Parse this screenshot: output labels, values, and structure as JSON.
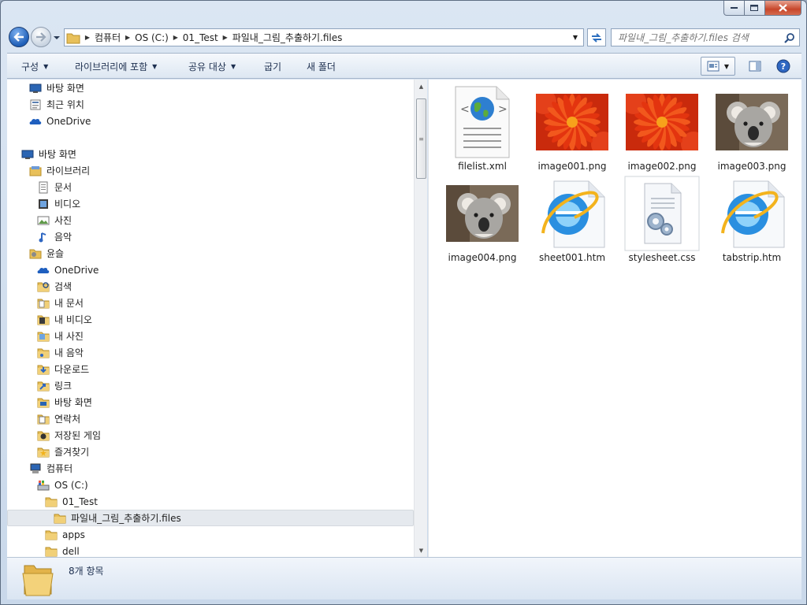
{
  "window": {
    "caption_buttons": [
      "minimize",
      "maximize",
      "close"
    ]
  },
  "address": {
    "segments": [
      "컴퓨터",
      "OS (C:)",
      "01_Test",
      "파일내_그림_추출하기.files"
    ]
  },
  "search": {
    "placeholder": "파일내_그림_추출하기.files 검색"
  },
  "toolbar": {
    "organize": "구성",
    "include_in_library": "라이브러리에 포함",
    "share_with": "공유 대상",
    "burn": "굽기",
    "new_folder": "새 폴더"
  },
  "nav": {
    "items": [
      {
        "label": "바탕 화면",
        "icon": "desktop-icon",
        "indent": 1
      },
      {
        "label": "최근 위치",
        "icon": "recent-places-icon",
        "indent": 1
      },
      {
        "label": "OneDrive",
        "icon": "onedrive-icon",
        "indent": 1
      },
      {
        "label": "바탕 화면",
        "icon": "desktop-icon",
        "indent": 0
      },
      {
        "label": "라이브러리",
        "icon": "libraries-icon",
        "indent": 1
      },
      {
        "label": "문서",
        "icon": "documents-icon",
        "indent": 2
      },
      {
        "label": "비디오",
        "icon": "videos-icon",
        "indent": 2
      },
      {
        "label": "사진",
        "icon": "pictures-icon",
        "indent": 2
      },
      {
        "label": "음악",
        "icon": "music-icon",
        "indent": 2
      },
      {
        "label": "윤슬",
        "icon": "user-folder-icon",
        "indent": 1
      },
      {
        "label": "OneDrive",
        "icon": "onedrive-icon",
        "indent": 2
      },
      {
        "label": "검색",
        "icon": "searches-folder-icon",
        "indent": 2
      },
      {
        "label": "내 문서",
        "icon": "my-documents-icon",
        "indent": 2
      },
      {
        "label": "내 비디오",
        "icon": "my-videos-icon",
        "indent": 2
      },
      {
        "label": "내 사진",
        "icon": "my-pictures-icon",
        "indent": 2
      },
      {
        "label": "내 음악",
        "icon": "my-music-icon",
        "indent": 2
      },
      {
        "label": "다운로드",
        "icon": "downloads-icon",
        "indent": 2
      },
      {
        "label": "링크",
        "icon": "links-icon",
        "indent": 2
      },
      {
        "label": "바탕 화면",
        "icon": "desktop-folder-icon",
        "indent": 2
      },
      {
        "label": "연락처",
        "icon": "contacts-icon",
        "indent": 2
      },
      {
        "label": "저장된 게임",
        "icon": "saved-games-icon",
        "indent": 2
      },
      {
        "label": "즐겨찾기",
        "icon": "favorites-icon",
        "indent": 2
      },
      {
        "label": "컴퓨터",
        "icon": "computer-icon",
        "indent": 1
      },
      {
        "label": "OS (C:)",
        "icon": "drive-icon",
        "indent": 2
      },
      {
        "label": "01_Test",
        "icon": "folder-icon",
        "indent": 3
      },
      {
        "label": "파일내_그림_추출하기.files",
        "icon": "folder-icon",
        "indent": 4,
        "selected": true
      },
      {
        "label": "apps",
        "icon": "folder-icon",
        "indent": 3
      },
      {
        "label": "dell",
        "icon": "folder-icon",
        "indent": 3
      }
    ]
  },
  "files": [
    {
      "name": "filelist.xml",
      "type": "xml"
    },
    {
      "name": "image001.png",
      "type": "flower"
    },
    {
      "name": "image002.png",
      "type": "flower"
    },
    {
      "name": "image003.png",
      "type": "koala"
    },
    {
      "name": "image004.png",
      "type": "koala"
    },
    {
      "name": "sheet001.htm",
      "type": "ie"
    },
    {
      "name": "stylesheet.css",
      "type": "css"
    },
    {
      "name": "tabstrip.htm",
      "type": "ie"
    }
  ],
  "status": {
    "item_count": "8개 항목"
  },
  "colors": {
    "selection_bg": "#e5e9ee",
    "toolbar_text": "#1e3050",
    "window_frame": "#c9d8ea"
  }
}
